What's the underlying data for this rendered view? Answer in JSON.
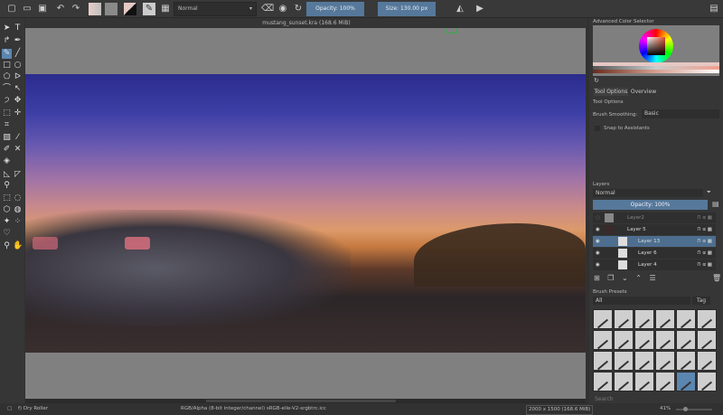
{
  "toolbar": {
    "blend_mode": "Normal",
    "opacity": "Opacity: 100%",
    "size": "Size: 130.00 px"
  },
  "document": {
    "title": "mustang_sunset.kra (168.6 MiB)"
  },
  "color_selector": {
    "title": "Advanced Color Selector"
  },
  "tool_options": {
    "tabs": [
      "Tool Options",
      "Overview"
    ],
    "title": "Tool Options",
    "brush_smoothing_label": "Brush Smoothing:",
    "brush_smoothing_value": "Basic",
    "snap_label": "Snap to Assistants"
  },
  "layers": {
    "title": "Layers",
    "blend_mode": "Normal",
    "opacity": "Opacity: 100%",
    "items": [
      {
        "name": "Layer2",
        "visible": false
      },
      {
        "name": "Layer 5",
        "visible": true
      },
      {
        "name": "Layer 13",
        "visible": true,
        "selected": true
      },
      {
        "name": "Layer 6",
        "visible": true
      },
      {
        "name": "Layer 4",
        "visible": true
      }
    ]
  },
  "brush_presets": {
    "title": "Brush Presets",
    "filter": "All",
    "tag": "Tag",
    "search_placeholder": "Search"
  },
  "status": {
    "brush": "f) Dry Roller",
    "color_space": "RGB/Alpha (8-bit integer/channel)  sRGB-elle-V2-srgbtrc.icc",
    "dimensions": "2000 x 1500 (168.6 MiB)",
    "zoom": "41%"
  },
  "colors": {
    "accent": "#56789a",
    "canvas_bg": "#808080"
  }
}
